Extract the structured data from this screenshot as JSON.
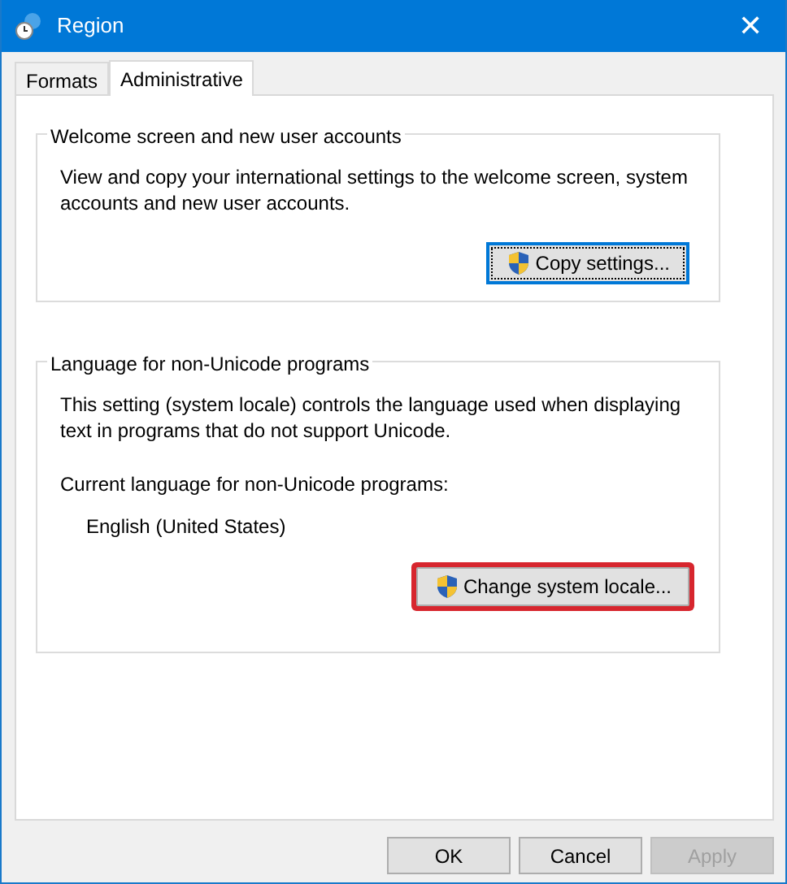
{
  "window": {
    "title": "Region",
    "close_glyph": "✕"
  },
  "tabs": [
    {
      "label": "Formats",
      "selected": false
    },
    {
      "label": "Administrative",
      "selected": true
    }
  ],
  "groups": [
    {
      "title": "Welcome screen and new user accounts",
      "description": "View and copy your international settings to the welcome screen, system accounts and new user accounts.",
      "button": {
        "label": "Copy settings...",
        "focused": true,
        "highlighted": false
      }
    },
    {
      "title": "Language for non-Unicode programs",
      "description": "This setting (system locale) controls the language used when displaying text in programs that do not support Unicode.",
      "current_label": "Current language for non-Unicode programs:",
      "current_value": "English (United States)",
      "button": {
        "label": "Change system locale...",
        "focused": false,
        "highlighted": true
      }
    }
  ],
  "buttons": [
    {
      "label": "OK",
      "disabled": false
    },
    {
      "label": "Cancel",
      "disabled": false
    },
    {
      "label": "Apply",
      "disabled": true
    }
  ]
}
